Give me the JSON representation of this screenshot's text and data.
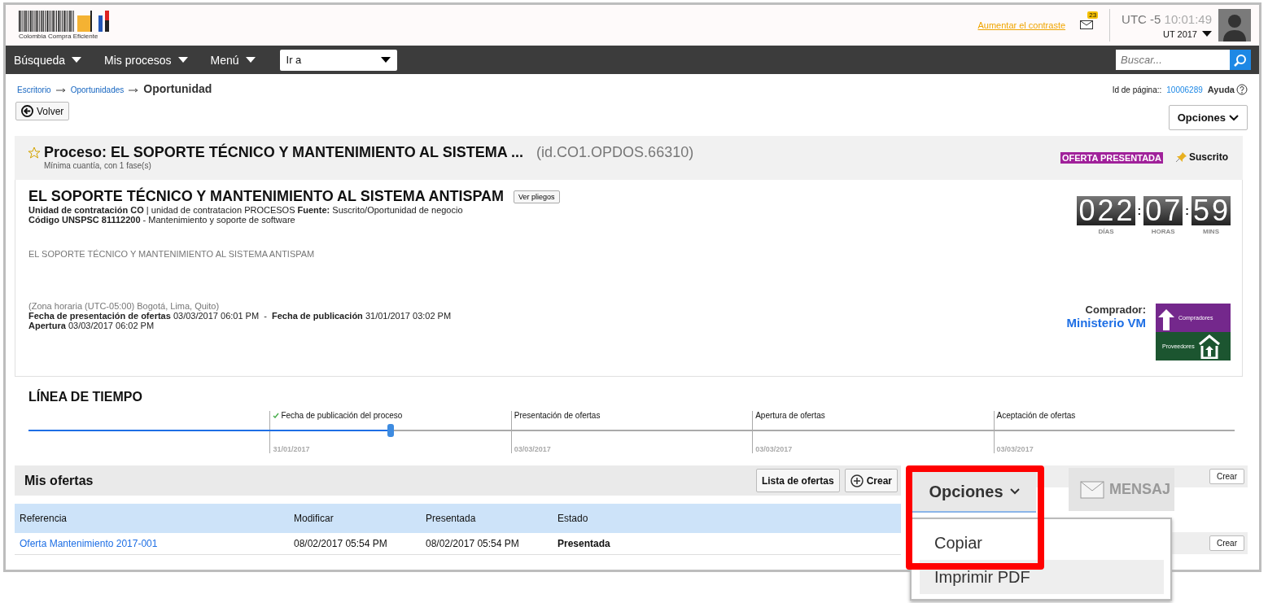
{
  "header": {
    "logo_text": "Colombia Compra Eficiente",
    "contrast_link": "Aumentar el contraste",
    "mail_count": "23",
    "timezone": "UTC -5",
    "time": "10:01:49",
    "user": "UT 2017"
  },
  "nav": {
    "items": [
      "Búsqueda",
      "Mis procesos",
      "Menú"
    ],
    "goto": "Ir a",
    "search_placeholder": "Buscar..."
  },
  "breadcrumb": {
    "links": [
      "Escritorio",
      "Oportunidades"
    ],
    "current": "Oportunidad",
    "page_id_label": "Id de página::",
    "page_id": "10006289",
    "help": "Ayuda"
  },
  "back_button": "Volver",
  "options_button": "Opciones",
  "process": {
    "title": "Proceso: EL SOPORTE TÉCNICO Y MANTENIMIENTO AL SISTEMA ...",
    "id": "(id.CO1.OPDOS.66310)",
    "subtitle": "Mínima cuantía, con 1 fase(s)",
    "status": "OFERTA PRESENTADA",
    "subscribed": "Suscrito"
  },
  "details": {
    "title": "EL SOPORTE TÉCNICO Y MANTENIMIENTO AL SISTEMA ANTISPAM",
    "ver_pliegos": "Ver pliegos",
    "line_1": "**Unidad de contratación CO** | unidad de contratacion PROCESOS **Fuente:** Suscrito/Oportunidad de negocio",
    "line_2": "**Código UNSPSC 81112200** - Mantenimiento y soporte de software",
    "description": "EL SOPORTE TÉCNICO Y MANTENIMIENTO AL SISTEMA ANTISPAM",
    "timezone": "(Zona horaria (UTC-05:00) Bogotá, Lima, Quito)",
    "dates": "**Fecha de presentación de ofertas** 03/03/2017 06:01 PM  -  **Fecha de publicación** 31/01/2017 03:02 PM",
    "opening": "**Apertura** 03/03/2017 06:02 PM",
    "countdown_separator": ":",
    "countdown": [
      {
        "value": "022",
        "unit": "DÍAS"
      },
      {
        "value": "07",
        "unit": "HORAS"
      },
      {
        "value": "59",
        "unit": "MINS"
      }
    ],
    "buyer_label": "Comprador:",
    "buyer": "Ministerio VM",
    "badge_top": "Compradores",
    "badge_bottom": "Proveedores"
  },
  "timeline": {
    "title": "LÍNEA DE TIEMPO",
    "level": 0.3,
    "milestones": [
      {
        "label": "Fecha de publicación del proceso",
        "date": "31/01/2017",
        "done": true
      },
      {
        "label": "Presentación de ofertas",
        "date": "03/03/2017",
        "done": false
      },
      {
        "label": "Apertura de ofertas",
        "date": "03/03/2017",
        "done": false
      },
      {
        "label": "Aceptación de ofertas",
        "date": "03/03/2017",
        "done": false
      }
    ]
  },
  "offers": {
    "title": "Mis ofertas",
    "list_button": "Lista de ofertas",
    "create_button": "Crear",
    "columns": [
      "Referencia",
      "Modificar",
      "Presentada",
      "Estado"
    ],
    "rows": [
      [
        "Oferta Mantenimiento 2017-001",
        "08/02/2017 05:54 PM",
        "08/02/2017 05:54 PM",
        "Presentada"
      ]
    ]
  },
  "side": {
    "messages": "MENSAJ",
    "create_buttons": [
      "Crear",
      "Crear"
    ]
  },
  "callout": {
    "button": "Opciones",
    "items": [
      {
        "label": "Copiar",
        "selected": false
      },
      {
        "label": "Imprimir PDF",
        "selected": true
      }
    ]
  }
}
